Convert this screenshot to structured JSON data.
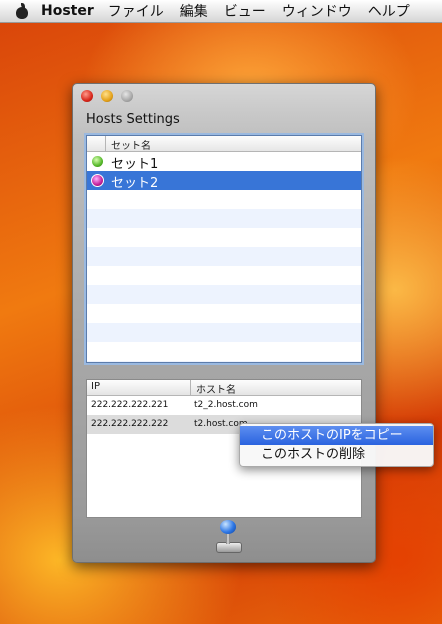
{
  "menubar": {
    "app_name": "Hoster",
    "items": [
      "ファイル",
      "編集",
      "ビュー",
      "ウィンドウ",
      "ヘルプ"
    ]
  },
  "window": {
    "title": "Hosts Settings"
  },
  "set_table": {
    "header": "セット名",
    "rows": [
      {
        "name": "セット1",
        "status": "green",
        "selected": false
      },
      {
        "name": "セット2",
        "status": "magenta",
        "selected": true
      }
    ]
  },
  "host_table": {
    "headers": [
      "IP",
      "ホスト名"
    ],
    "rows": [
      {
        "ip": "222.222.222.221",
        "host": "t2_2.host.com"
      },
      {
        "ip": "222.222.222.222",
        "host": "t2.host.com"
      }
    ]
  },
  "context_menu": {
    "items": [
      "このホストのIPをコピー",
      "このホストの削除"
    ],
    "highlighted_index": 0
  },
  "icons": {
    "apple": "apple-logo-icon",
    "bottom": "joystick-icon"
  },
  "colors": {
    "selection": "#3875d7",
    "status_green": "#56b82a",
    "status_magenta": "#c4209a"
  }
}
